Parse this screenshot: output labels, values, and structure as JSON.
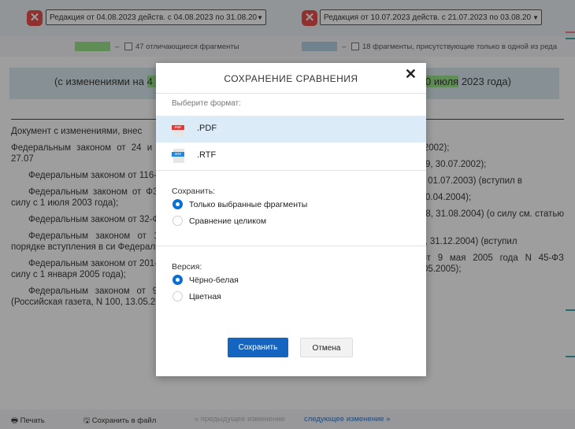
{
  "toolbar": {
    "left_version": "Редакция от 04.08.2023 действ. с 04.08.2023 по 31.08.20",
    "right_version": "Редакция от 10.07.2023 действ. с 21.07.2023 по 03.08.20"
  },
  "legend": {
    "left_text": "47 отличающиеся фрагменты",
    "right_text": "18 фрагменты, присутствующие только в одной из реда",
    "left_color": "#8fe07b",
    "right_color": "#a9cde0"
  },
  "doc": {
    "banner_left_pre": "(с изменениями на ",
    "banner_left_hl": "4 ав",
    "banner_right_hl": "0 июля",
    "banner_right_post": " 2023 года)",
    "left_paragraphs": [
      "Документ с изменениями, внес",
      "Федеральным законом от 24 и (Российская газета, N 137, 27.07",
      "Федеральным законом от 116-ФЗ (Российская газета, N 1",
      "Федеральным законом от ФЗ (Российская газета, N 126 силу с 1 июля 2003 года);",
      "Федеральным законом от 32-ФЗ (Российская газета, N 92",
      "Федеральным законом от 122-ФЗ (Российская газета, порядке вступления в си Федерального закона от 22 ав ФЗ);",
      "Федеральным законом от 201-ФЗ (Российская газета, N 2 в силу с 1 января 2005 года);",
      "Федеральным законом от 9 мая 2005 года N 45-ФЗ (Российская газета, N 100, 13.05.2005);"
    ],
    "right_paragraphs": [
      "есенными:",
      "4 июля 2002 года N 97-ФЗ .07.2002);",
      "от 25 июля 2002 года N 138-139, 30.07.2002);",
      "от 30 июня 2003 года N 86- 26, 01.07.2003) (вступил в",
      "от 27 апреля 2004 года N 92, 30.04.2004);",
      "от 22 августа 2004 года N N 188, 31.08.2004) (о силу см. статью 155 августа 2004 года N 122-",
      "от 29 декабря 2004 года N 292, 31.12.2004) (вступил",
      "Федеральным законом от 9 мая 2005 года N 45-ФЗ (Российская газета, N 100, 13.05.2005);"
    ]
  },
  "modal": {
    "title": "СОХРАНЕНИЕ СРАВНЕНИЯ",
    "close": "✕",
    "format_label": "Выберите формат:",
    "formats": [
      {
        "label": ".PDF",
        "tag": "PDF",
        "color": "#e53935"
      },
      {
        "label": ".RTF",
        "tag": "RTF",
        "color": "#1e88e5"
      }
    ],
    "save_section": "Сохранить:",
    "save_options": [
      "Только выбранные фрагменты",
      "Сравнение целиком"
    ],
    "version_section": "Версия:",
    "version_options": [
      "Чёрно-белая",
      "Цветная"
    ],
    "save_button": "Сохранить",
    "cancel_button": "Отмена"
  },
  "bottom": {
    "print": "Печать",
    "save_file": "Сохранить в файл",
    "prev_change": "« предыдущее изменение",
    "next_change": "следующее изменение »"
  }
}
